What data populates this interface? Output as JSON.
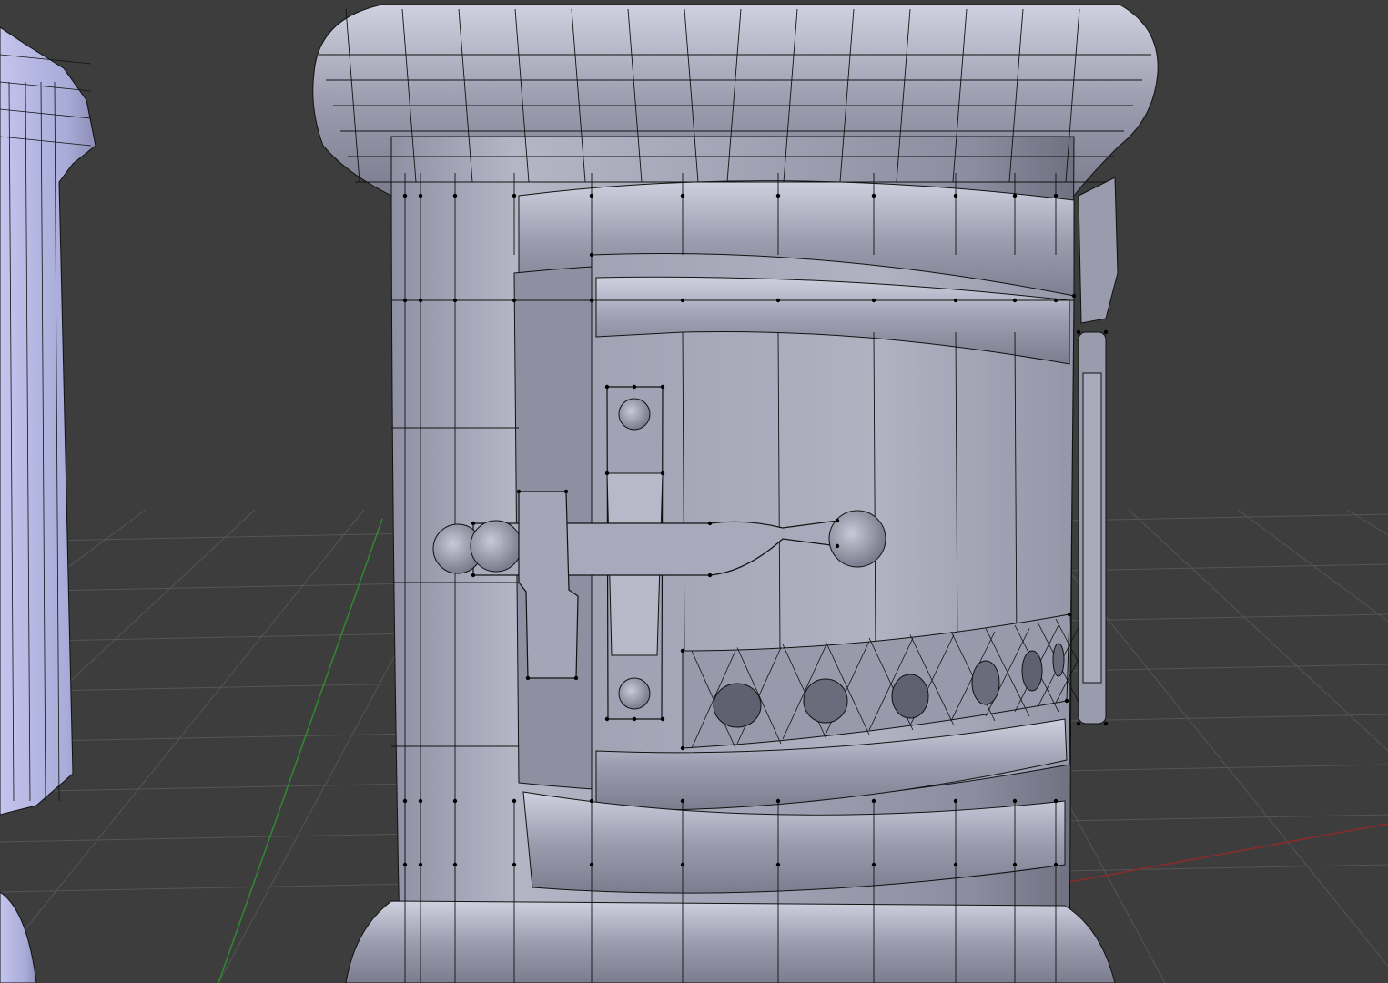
{
  "app": {
    "mode": "3d-viewport",
    "shading": "solid-with-wireframe-overlay"
  },
  "viewport": {
    "background_color": "#3d3d3d",
    "grid_color": "#555555",
    "axis_x_color": "#8a2b2b",
    "axis_y_color": "#2f8a2f",
    "mesh_base_color": "#a6a8bc",
    "mesh_highlight_color": "#c5c7d8",
    "mesh_shadow_color": "#6f7080",
    "wire_color": "#111111",
    "vertex_color": "#000000",
    "left_object_color": "#b9bbe6"
  },
  "scene": {
    "objects": [
      {
        "name_icon": "cylinder-mesh-icon",
        "role": "main-barrel"
      },
      {
        "name_icon": "cylinder-mesh-icon",
        "role": "left-neighbor-object"
      },
      {
        "name_icon": "latch-mesh-icon",
        "role": "door-latch"
      },
      {
        "name_icon": "hinge-mesh-icon",
        "role": "door-hinge"
      }
    ]
  }
}
